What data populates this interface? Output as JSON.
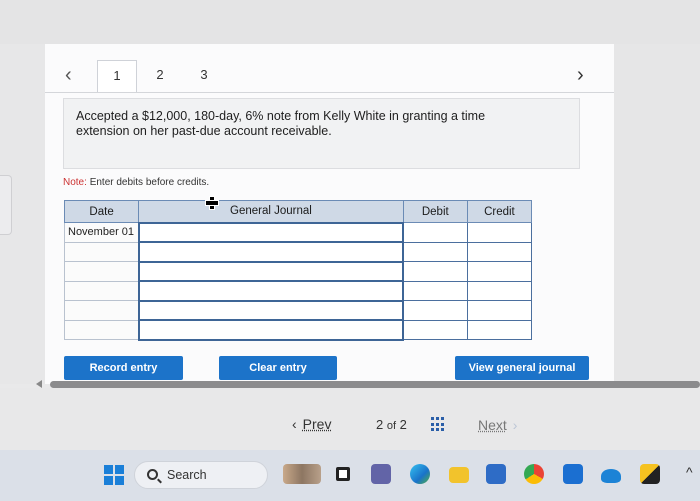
{
  "tabs": [
    {
      "label": "1",
      "active": true
    },
    {
      "label": "2",
      "active": false
    },
    {
      "label": "3",
      "active": false
    }
  ],
  "nav": {
    "prev_icon": "chevron-left-icon",
    "next_icon": "chevron-right-icon"
  },
  "prompt": {
    "text": "Accepted a $12,000, 180-day, 6% note from Kelly White in granting a time extension on her past-due account receivable."
  },
  "note": {
    "prefix": "Note:",
    "text": "Enter debits before credits."
  },
  "journal": {
    "headers": {
      "date": "Date",
      "account": "General Journal",
      "debit": "Debit",
      "credit": "Credit"
    },
    "rows": [
      {
        "date": "November 01",
        "account": "",
        "debit": "",
        "credit": ""
      },
      {
        "date": "",
        "account": "",
        "debit": "",
        "credit": ""
      },
      {
        "date": "",
        "account": "",
        "debit": "",
        "credit": ""
      },
      {
        "date": "",
        "account": "",
        "debit": "",
        "credit": ""
      },
      {
        "date": "",
        "account": "",
        "debit": "",
        "credit": ""
      },
      {
        "date": "",
        "account": "",
        "debit": "",
        "credit": ""
      }
    ]
  },
  "buttons": {
    "record": "Record entry",
    "clear": "Clear entry",
    "view": "View general journal"
  },
  "pager": {
    "prev": "Prev",
    "current": "2",
    "of": "of",
    "total": "2",
    "next": "Next"
  },
  "taskbar": {
    "search": "Search"
  },
  "colors": {
    "accent": "#1c73c9",
    "table_border": "#4b6f9e",
    "header_bg": "#cfd9e6"
  }
}
